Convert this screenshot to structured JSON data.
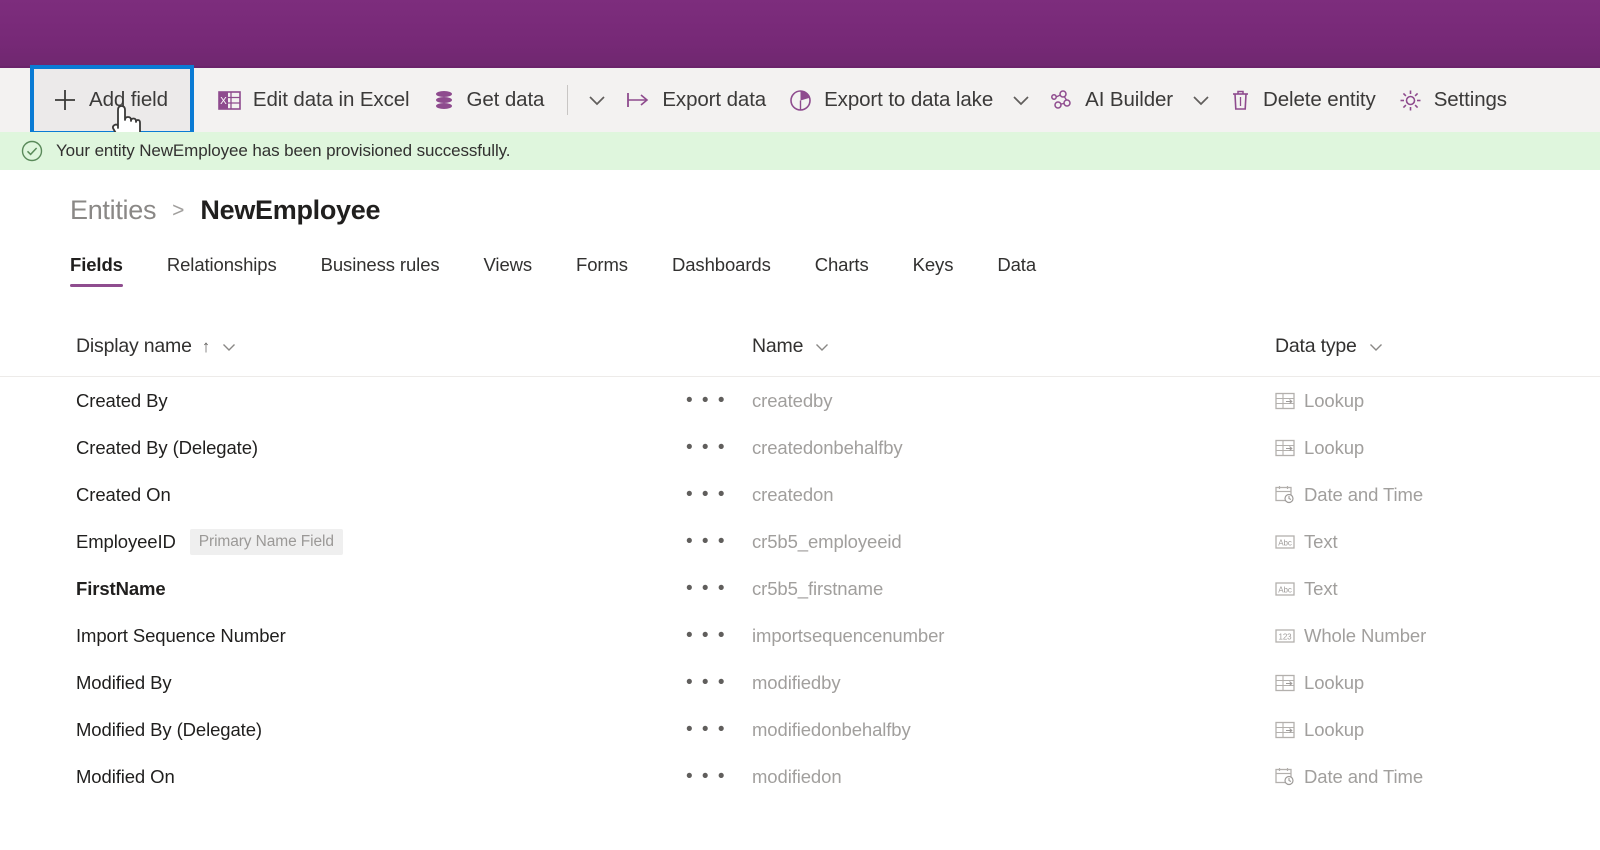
{
  "header": {
    "accent_color": "#7d2d7d"
  },
  "toolbar": {
    "add_field": "Add field",
    "edit_in_excel": "Edit data in Excel",
    "get_data": "Get data",
    "export_data": "Export data",
    "export_to_data_lake": "Export to data lake",
    "ai_builder": "AI Builder",
    "delete_entity": "Delete entity",
    "settings": "Settings"
  },
  "message": {
    "text": "Your entity NewEmployee has been provisioned successfully.",
    "background_color": "#dff6dd",
    "icon": "check-circle-icon"
  },
  "breadcrumb": {
    "parent": "Entities",
    "separator": ">",
    "current": "NewEmployee"
  },
  "tabs": [
    {
      "label": "Fields",
      "active": true
    },
    {
      "label": "Relationships",
      "active": false
    },
    {
      "label": "Business rules",
      "active": false
    },
    {
      "label": "Views",
      "active": false
    },
    {
      "label": "Forms",
      "active": false
    },
    {
      "label": "Dashboards",
      "active": false
    },
    {
      "label": "Charts",
      "active": false
    },
    {
      "label": "Keys",
      "active": false
    },
    {
      "label": "Data",
      "active": false
    }
  ],
  "grid": {
    "columns": [
      {
        "label": "Display name",
        "sort": "↑"
      },
      {
        "label": "Name",
        "sort": ""
      },
      {
        "label": "Data type",
        "sort": ""
      }
    ],
    "row_menu_glyph": "• • •",
    "primary_name_badge": "Primary Name Field",
    "rows": [
      {
        "display": "Created By",
        "bold": false,
        "badge": "",
        "name": "createdby",
        "type": "Lookup",
        "type_icon": "lookup-icon"
      },
      {
        "display": "Created By (Delegate)",
        "bold": false,
        "badge": "",
        "name": "createdonbehalfby",
        "type": "Lookup",
        "type_icon": "lookup-icon"
      },
      {
        "display": "Created On",
        "bold": false,
        "badge": "",
        "name": "createdon",
        "type": "Date and Time",
        "type_icon": "datetime-icon"
      },
      {
        "display": "EmployeeID",
        "bold": false,
        "badge": "Primary Name Field",
        "name": "cr5b5_employeeid",
        "type": "Text",
        "type_icon": "text-icon"
      },
      {
        "display": "FirstName",
        "bold": true,
        "badge": "",
        "name": "cr5b5_firstname",
        "type": "Text",
        "type_icon": "text-icon"
      },
      {
        "display": "Import Sequence Number",
        "bold": false,
        "badge": "",
        "name": "importsequencenumber",
        "type": "Whole Number",
        "type_icon": "number-icon"
      },
      {
        "display": "Modified By",
        "bold": false,
        "badge": "",
        "name": "modifiedby",
        "type": "Lookup",
        "type_icon": "lookup-icon"
      },
      {
        "display": "Modified By (Delegate)",
        "bold": false,
        "badge": "",
        "name": "modifiedonbehalfby",
        "type": "Lookup",
        "type_icon": "lookup-icon"
      },
      {
        "display": "Modified On",
        "bold": false,
        "badge": "",
        "name": "modifiedon",
        "type": "Date and Time",
        "type_icon": "datetime-icon"
      }
    ]
  }
}
